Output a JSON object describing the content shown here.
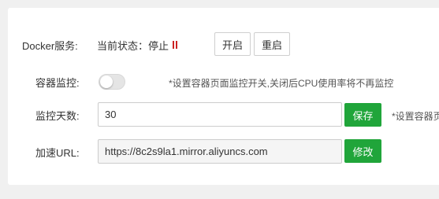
{
  "docker": {
    "label": "Docker服务:",
    "status_text": "当前状态：停止",
    "start_label": "开启",
    "restart_label": "重启",
    "status_color": "#cc2222"
  },
  "monitor": {
    "label": "容器监控:",
    "enabled": false,
    "hint": "*设置容器页面监控开关,关闭后CPU使用率将不再监控"
  },
  "days": {
    "label": "监控天数:",
    "value": "30",
    "save_label": "保存",
    "hint": "*设置容器页"
  },
  "mirror": {
    "label": "加速URL:",
    "value": "https://8c2s9la1.mirror.aliyuncs.com",
    "modify_label": "修改"
  },
  "colors": {
    "accent": "#20a53a",
    "background": "#f0f0f0"
  }
}
